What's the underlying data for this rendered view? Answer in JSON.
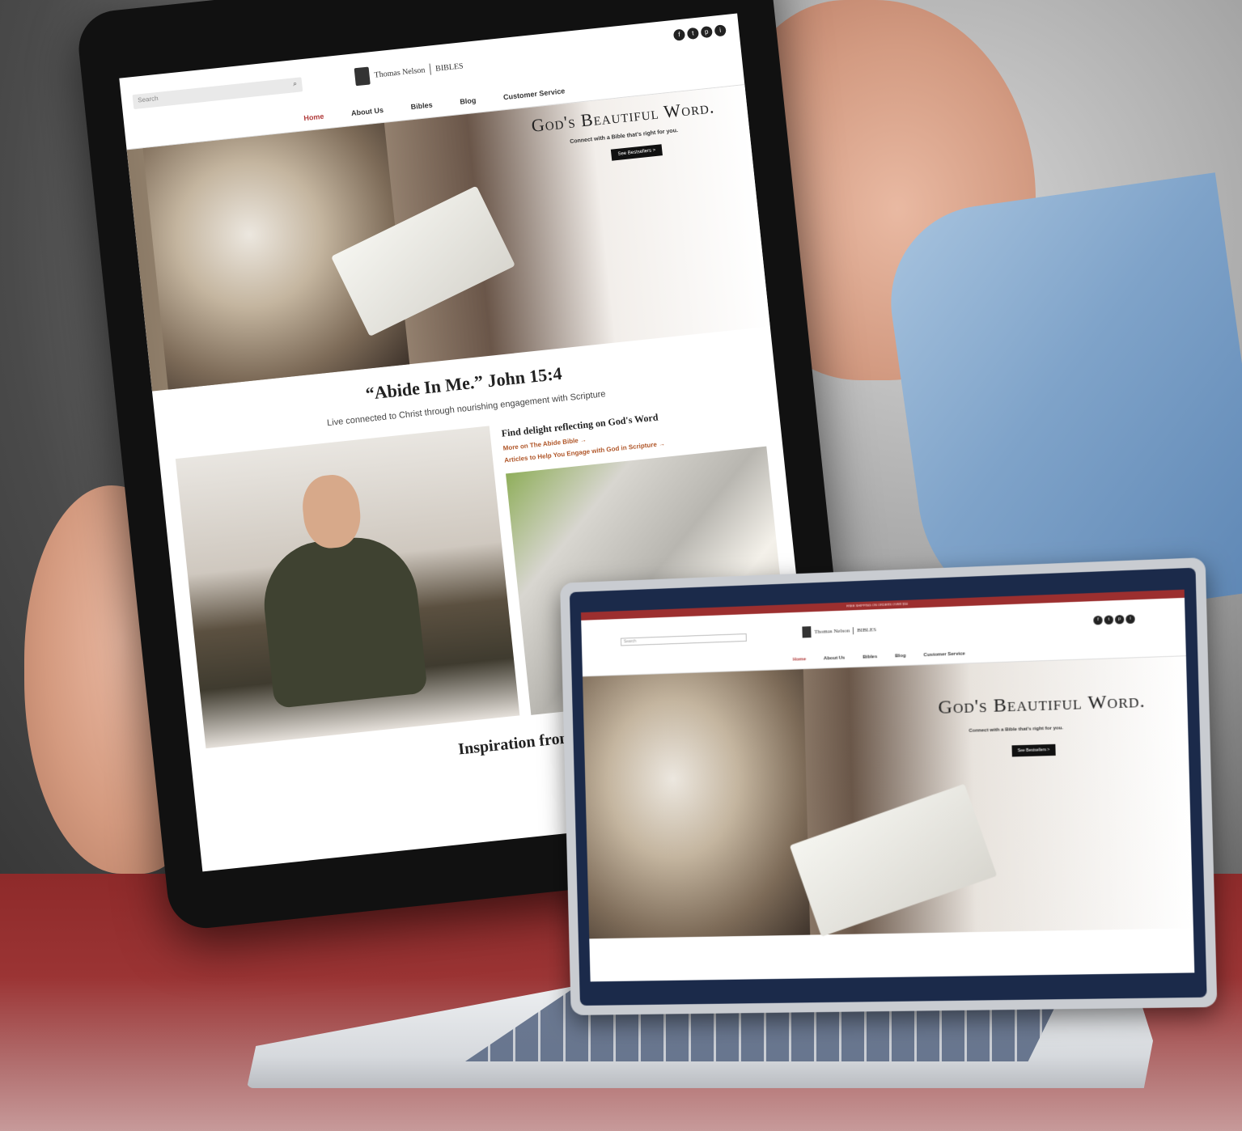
{
  "tablet": {
    "search_placeholder": "Search",
    "logo_text": "Thomas Nelson",
    "logo_sub": "BIBLES",
    "social": [
      "f",
      "t",
      "p",
      "i"
    ],
    "nav": [
      "Home",
      "About Us",
      "Bibles",
      "Blog",
      "Customer Service"
    ],
    "hero_title": "God's Beautiful Word.",
    "hero_subtitle": "Connect with a Bible that's right for you.",
    "hero_button": "See Bestsellers >",
    "quote": "“Abide In Me.” John 15:4",
    "quote_sub": "Live connected to Christ through nourishing engagement with Scripture",
    "side_heading": "Find delight reflecting on God's Word",
    "side_links": [
      "More on The Abide Bible →",
      "Articles to Help You Engage with God in Scripture →"
    ],
    "inspiration": "Inspiration fron"
  },
  "laptop": {
    "topbar": "FREE SHIPPING ON ORDERS OVER $50",
    "search_placeholder": "Search",
    "logo_text": "Thomas Nelson",
    "logo_sub": "BIBLES",
    "social": [
      "f",
      "t",
      "p",
      "i"
    ],
    "nav": [
      "Home",
      "About Us",
      "Bibles",
      "Blog",
      "Customer Service"
    ],
    "hero_title": "God's Beautiful Word.",
    "hero_subtitle": "Connect with a Bible that's right for you.",
    "hero_button": "See Bestsellers >"
  },
  "colors": {
    "accent": "#b03a3a",
    "desk": "#9b3434",
    "laptop_bezel": "#1b2a4a"
  }
}
